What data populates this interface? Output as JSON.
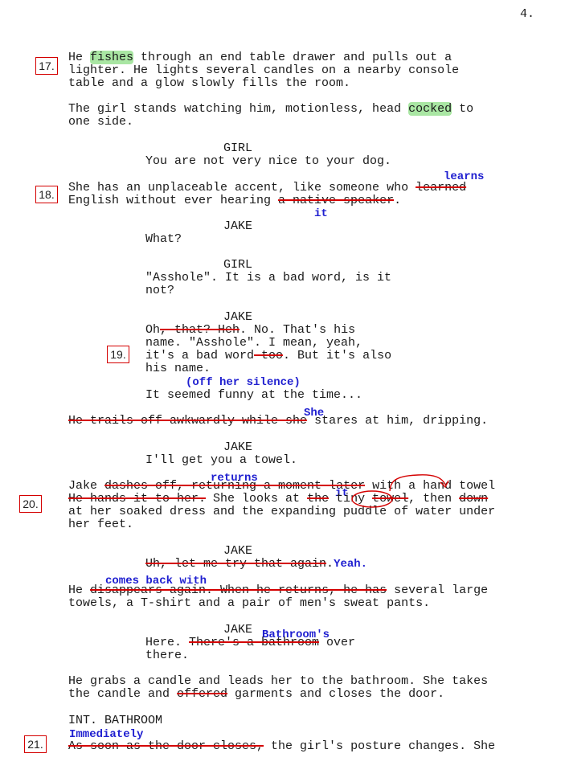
{
  "page_number": "4.",
  "scene_numbers": {
    "s17": "17.",
    "s18": "18.",
    "s19": "19.",
    "s20": "20.",
    "s21": "21."
  },
  "colors": {
    "strike": "#d40000",
    "insert": "#1f1fd0",
    "highlight": "#a9e6a3",
    "box": "#d40000"
  },
  "lines": {
    "p1a_pre": "He ",
    "p1a_hl": "fishes",
    "p1a_post": " through an end table drawer and pulls out a",
    "p1b": "lighter. He lights several candles on a nearby console",
    "p1c": "table and a glow slowly fills the room.",
    "p2a_pre": "The girl stands watching him, motionless, head ",
    "p2a_hl": "cocked",
    "p2a_post": " to",
    "p2b": "one side.",
    "girl_1": "GIRL",
    "d1": "You are not very nice to your dog.",
    "p3a_pre": "She has an unplaceable accent, like someone who ",
    "p3a_strike": "learned",
    "p3b_pre": "English without ever hearing ",
    "p3b_strike": "a native speaker",
    "p3b_post": ".",
    "jake_1": "JAKE",
    "d2": "What?",
    "girl_2": "GIRL",
    "d3a": "\"Asshole\". It is a bad word, is it",
    "d3b": "not?",
    "jake_2": "JAKE",
    "d4a_pre": "Oh",
    "d4a_strike": ", that? Heh",
    "d4a_post": ". No. That's his",
    "d4b": "name. \"Asshole\". I mean, yeah,",
    "d4c_pre": "it's a bad word",
    "d4c_strike": " too",
    "d4c_post": ". But it's also",
    "d4d": "his name.",
    "d4e": "It seemed funny at the time...",
    "p4_strike": "He trails off awkwardly while she",
    "p4_post": " stares at him, dripping.",
    "jake_3": "JAKE",
    "d5": "I'll get you a towel.",
    "p5a_pre": "Jake ",
    "p5a_strike": "dashes off, returning a moment later",
    "p5a_post": " with a hand towel",
    "p5b_strike1": "He hands it to her.",
    "p5b_mid": " She looks at ",
    "p5b_strike2": "the",
    "p5b_sp": " ",
    "p5b_circ": "tiny",
    "p5b_sp2": " ",
    "p5b_strike3": "towel",
    "p5b_mid2": ", then ",
    "p5b_strike4": "down",
    "p5c": "at her soaked dress and the expanding puddle of water under",
    "p5d": "her feet.",
    "jake_4": "JAKE",
    "d6_strike": "Uh, let me try that again",
    "d6_post": ".",
    "p6a_pre": "He ",
    "p6a_strike": "disappears again. When he returns, he has",
    "p6a_post": " several large",
    "p6b": "towels, a T-shirt and a pair of men's sweat pants.",
    "jake_5": "JAKE",
    "d7a_pre": "Here. ",
    "d7a_strike": "There's a bathroom",
    "d7a_post": " over",
    "d7b": "there.",
    "p7a": "He grabs a candle and leads her to the bathroom. She takes",
    "p7b_pre": "the candle and ",
    "p7b_strike": "offered",
    "p7b_post": " garments and closes the door.",
    "slug": "INT. BATHROOM",
    "p8_strike": "As soon as the door closes,",
    "p8_post": " the girl's posture changes. She"
  },
  "edits": {
    "learns": "learns",
    "it": "it",
    "yeah": "Yeah.",
    "off_her_silence": "(off her silence)",
    "she": "She",
    "returns": "returns",
    "it2": "it",
    "comes_back_with": "comes back with",
    "bathrooms": "Bathroom's",
    "immediately": "Immediately"
  }
}
